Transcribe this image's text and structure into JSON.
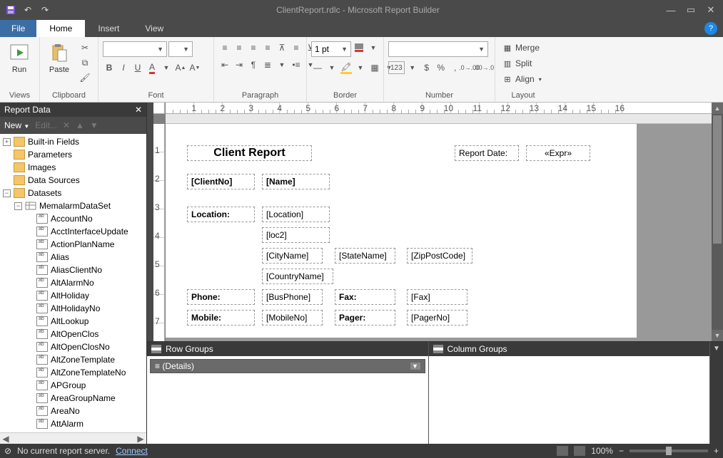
{
  "app": {
    "title": "ClientReport.rdlc - Microsoft Report Builder"
  },
  "menu": {
    "file": "File",
    "tabs": [
      "Home",
      "Insert",
      "View"
    ],
    "activeTab": "Home"
  },
  "ribbon": {
    "views": {
      "run": "Run",
      "label": "Views"
    },
    "clipboard": {
      "paste": "Paste",
      "label": "Clipboard"
    },
    "font": {
      "label": "Font",
      "family": "",
      "size": ""
    },
    "paragraph": {
      "label": "Paragraph"
    },
    "border": {
      "label": "Border",
      "width": "1 pt"
    },
    "number": {
      "label": "Number",
      "format": ""
    },
    "layout": {
      "label": "Layout",
      "merge": "Merge",
      "split": "Split",
      "align": "Align"
    }
  },
  "reportData": {
    "title": "Report Data",
    "new": "New",
    "edit": "Edit...",
    "tree": {
      "builtin": "Built-in Fields",
      "parameters": "Parameters",
      "images": "Images",
      "dataSources": "Data Sources",
      "datasets": "Datasets",
      "dataset": "MemalarmDataSet",
      "fields": [
        "AccountNo",
        "AcctInterfaceUpdate",
        "ActionPlanName",
        "Alias",
        "AliasClientNo",
        "AltAlarmNo",
        "AltHoliday",
        "AltHolidayNo",
        "AltLookup",
        "AltOpenClos",
        "AltOpenClosNo",
        "AltZoneTemplate",
        "AltZoneTemplateNo",
        "APGroup",
        "AreaGroupName",
        "AreaNo",
        "AttAlarm"
      ]
    }
  },
  "ruler": {
    "marks": [
      "1",
      "2",
      "3",
      "4",
      "5",
      "6",
      "7",
      "8",
      "9",
      "10",
      "11",
      "12",
      "13",
      "14",
      "15",
      "16"
    ],
    "vmarks": [
      "1",
      "2",
      "3",
      "4",
      "5",
      "6",
      "7"
    ]
  },
  "report": {
    "title": "Client Report",
    "reportDateLabel": "Report Date:",
    "expr": "«Expr»",
    "clientNo": "[ClientNo]",
    "name": "[Name]",
    "locationLabel": "Location:",
    "location": "[Location]",
    "loc2": "[loc2]",
    "city": "[CityName]",
    "state": "[StateName]",
    "zip": "[ZipPostCode]",
    "country": "[CountryName]",
    "phoneLabel": "Phone:",
    "phone": "[BusPhone]",
    "faxLabel": "Fax:",
    "fax": "[Fax]",
    "mobileLabel": "Mobile:",
    "mobile": "[MobileNo]",
    "pagerLabel": "Pager:",
    "pager": "[PagerNo]"
  },
  "groups": {
    "row": "Row Groups",
    "col": "Column Groups",
    "details": "(Details)"
  },
  "status": {
    "icon": "⊘",
    "msg": "No current report server.",
    "connect": "Connect",
    "zoom": "100%"
  }
}
